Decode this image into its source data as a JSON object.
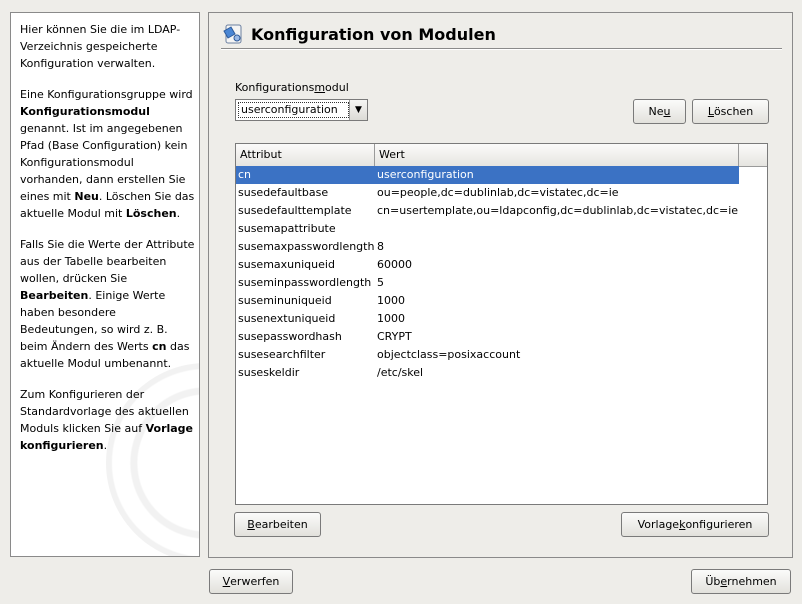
{
  "help": {
    "paragraphs": [
      [
        {
          "t": "Hier können Sie die im LDAP-Verzeichnis gespeicherte Konfiguration verwalten.",
          "b": false
        }
      ],
      [
        {
          "t": "Eine Konfigurationsgruppe wird ",
          "b": false
        },
        {
          "t": "Konfigurationsmodul",
          "b": true
        },
        {
          "t": " genannt. Ist im angegebenen Pfad (Base Configuration) kein Konfigurationsmodul vorhanden, dann erstellen Sie eines mit ",
          "b": false
        },
        {
          "t": "Neu",
          "b": true
        },
        {
          "t": ". Löschen Sie das aktuelle Modul mit ",
          "b": false
        },
        {
          "t": "Löschen",
          "b": true
        },
        {
          "t": ".",
          "b": false
        }
      ],
      [
        {
          "t": "Falls Sie die Werte der Attribute aus der Tabelle bearbeiten wollen, drücken Sie ",
          "b": false
        },
        {
          "t": "Bearbeiten",
          "b": true
        },
        {
          "t": ". Einige Werte haben besondere Bedeutungen, so wird z. B. beim Ändern des Werts ",
          "b": false
        },
        {
          "t": "cn",
          "b": true
        },
        {
          "t": " das aktuelle Modul umbenannt.",
          "b": false
        }
      ],
      [
        {
          "t": "Zum Konfigurieren der Standardvorlage des aktuellen Moduls klicken Sie auf ",
          "b": false
        },
        {
          "t": "Vorlage konfigurieren",
          "b": true
        },
        {
          "t": ".",
          "b": false
        }
      ]
    ]
  },
  "main": {
    "title": "Konfiguration von Modulen",
    "module_label": "Konfigurationsmodul",
    "module_value": "userconfiguration",
    "buttons": {
      "new": "Neu",
      "delete": "Löschen",
      "edit": "Bearbeiten",
      "configure_template": "Vorlage konfigurieren"
    },
    "table": {
      "columns": [
        "Attribut",
        "Wert"
      ],
      "selected_index": 0,
      "rows": [
        [
          "cn",
          "userconfiguration"
        ],
        [
          "susedefaultbase",
          "ou=people,dc=dublinlab,dc=vistatec,dc=ie"
        ],
        [
          "susedefaulttemplate",
          "cn=usertemplate,ou=ldapconfig,dc=dublinlab,dc=vistatec,dc=ie"
        ],
        [
          "susemapattribute",
          ""
        ],
        [
          "susemaxpasswordlength",
          "8"
        ],
        [
          "susemaxuniqueid",
          "60000"
        ],
        [
          "suseminpasswordlength",
          "5"
        ],
        [
          "suseminuniqueid",
          "1000"
        ],
        [
          "susenextuniqueid",
          "1000"
        ],
        [
          "susepasswordhash",
          "CRYPT"
        ],
        [
          "susesearchfilter",
          "objectclass=posixaccount"
        ],
        [
          "suseskeldir",
          "/etc/skel"
        ]
      ]
    }
  },
  "footer": {
    "discard": "Verwerfen",
    "accept": "Übernehmen"
  },
  "colors": {
    "selection": "#3b72c4",
    "background": "#eeede9"
  }
}
